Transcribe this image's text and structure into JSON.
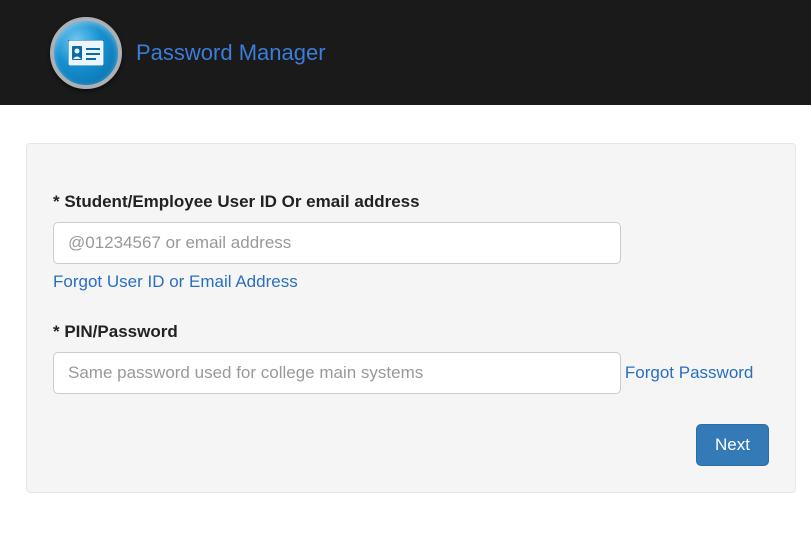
{
  "header": {
    "title": "Password Manager"
  },
  "form": {
    "userid": {
      "label": "* Student/Employee User ID Or email address",
      "placeholder": "@01234567 or email address",
      "forgot_link": "Forgot User ID or Email Address"
    },
    "password": {
      "label": "* PIN/Password",
      "placeholder": "Same password used for college main systems",
      "forgot_link": "Forgot Password"
    },
    "next_button": "Next"
  }
}
